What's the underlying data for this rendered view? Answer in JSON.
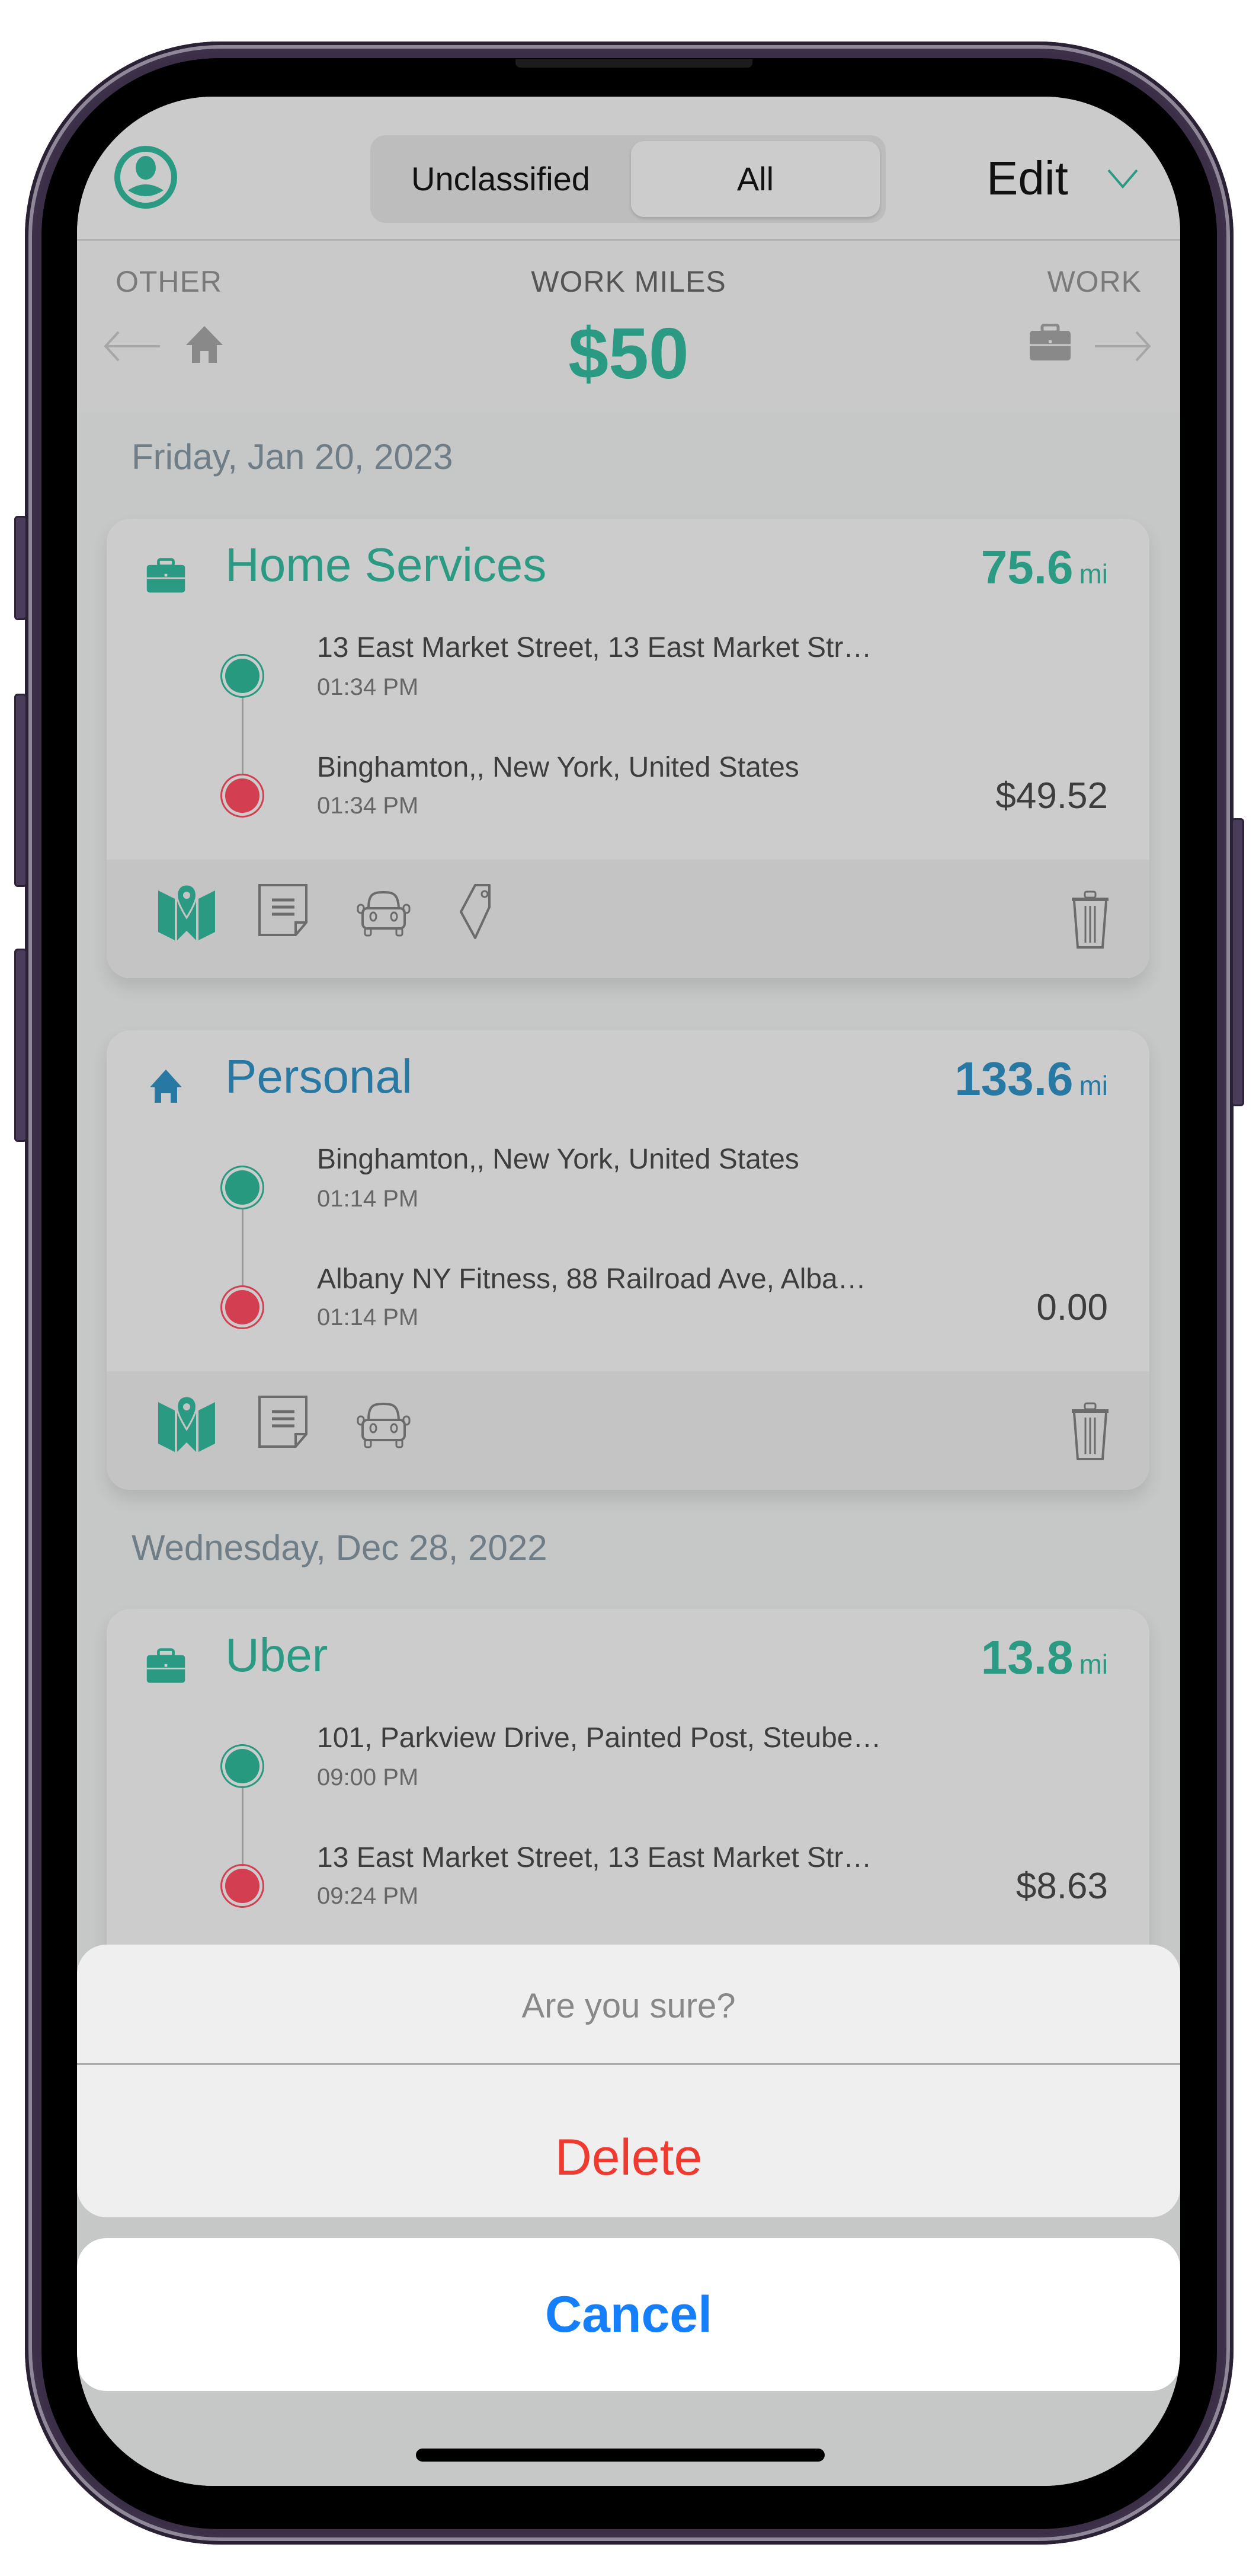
{
  "colors": {
    "accent_green": "#2a9a82",
    "personal_blue": "#2779a3",
    "start_dot": "#27997f",
    "end_dot": "#d33f51",
    "delete_red": "#f0392f",
    "cancel_blue": "#157efb"
  },
  "header": {
    "avatar_icon": "user-circle-icon",
    "segments": [
      {
        "label": "Unclassified",
        "selected": false
      },
      {
        "label": "All",
        "selected": true
      }
    ],
    "edit_label": "Edit",
    "edit_icon": "chevron-down-icon"
  },
  "summary": {
    "left_label": "OTHER",
    "center_label": "WORK MILES",
    "right_label": "WORK",
    "amount": "$50",
    "left_icons": [
      "arrow-left-icon",
      "home-icon"
    ],
    "right_icons": [
      "briefcase-icon",
      "arrow-right-icon"
    ]
  },
  "groups": [
    {
      "date": "Friday, Jan 20, 2023",
      "trips": [
        {
          "category": "Home Services",
          "category_type": "work",
          "miles": "75.6",
          "unit": "mi",
          "start_address": "13 East Market Street, 13 East Market Str…",
          "start_time": "01:34 PM",
          "end_address": "Binghamton,, New York, United States",
          "end_time": "01:34 PM",
          "value": "$49.52",
          "actions": [
            "map-icon",
            "notes-icon",
            "car-icon",
            "tag-icon"
          ],
          "delete_icon": "trash-icon"
        },
        {
          "category": "Personal",
          "category_type": "personal",
          "miles": "133.6",
          "unit": "mi",
          "start_address": "Binghamton,, New York, United States",
          "start_time": "01:14 PM",
          "end_address": "Albany NY Fitness, 88 Railroad Ave, Alba…",
          "end_time": "01:14 PM",
          "value": "0.00",
          "actions": [
            "map-icon",
            "notes-icon",
            "car-icon"
          ],
          "delete_icon": "trash-icon"
        }
      ]
    },
    {
      "date": "Wednesday, Dec 28, 2022",
      "trips": [
        {
          "category": "Uber",
          "category_type": "work",
          "miles": "13.8",
          "unit": "mi",
          "start_address": "101, Parkview Drive, Painted Post, Steube…",
          "start_time": "09:00 PM",
          "end_address": "13 East Market Street, 13 East Market Str…",
          "end_time": "09:24 PM",
          "value": "$8.63"
        }
      ]
    }
  ],
  "action_sheet": {
    "title": "Are you sure?",
    "destructive_label": "Delete",
    "cancel_label": "Cancel"
  }
}
